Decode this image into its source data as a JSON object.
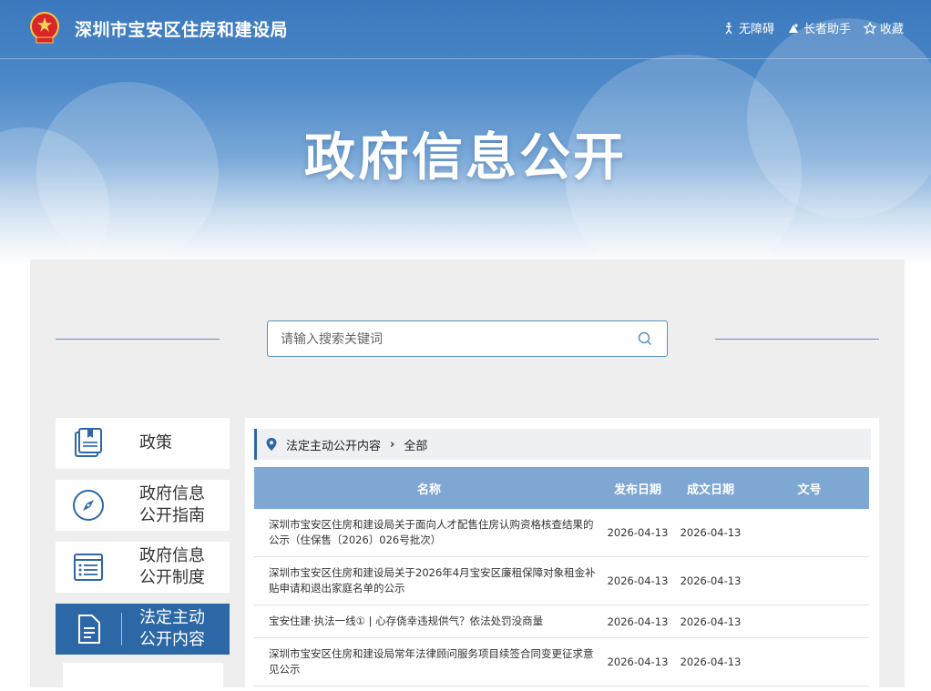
{
  "header": {
    "site_title": "深圳市宝安区住房和建设局",
    "links": [
      {
        "label": "无障碍",
        "icon": "accessibility-icon"
      },
      {
        "label": "长者助手",
        "icon": "elder-assist-icon"
      },
      {
        "label": "收藏",
        "icon": "star-icon"
      }
    ],
    "hero_title": "政府信息公开"
  },
  "search": {
    "placeholder": "请输入搜索关键词",
    "value": ""
  },
  "sidebar": {
    "items": [
      {
        "label": "政策",
        "icon": "policy-book-icon",
        "active": false
      },
      {
        "label": "政府信息公开指南",
        "line1": "政府信息",
        "line2": "公开指南",
        "icon": "compass-icon",
        "active": false
      },
      {
        "label": "政府信息公开制度",
        "line1": "政府信息",
        "line2": "公开制度",
        "icon": "list-document-icon",
        "active": false
      },
      {
        "label": "法定主动公开内容",
        "line1": "法定主动",
        "line2": "公开内容",
        "icon": "document-icon",
        "active": true
      }
    ]
  },
  "breadcrumb": {
    "section": "法定主动公开内容",
    "current": "全部"
  },
  "table": {
    "headers": [
      "名称",
      "发布日期",
      "成文日期",
      "文号"
    ],
    "rows": [
      {
        "title": "深圳市宝安区住房和建设局关于面向人才配售住房认购资格核查结果的公示（住保售〔2026〕026号批次）",
        "publish": "2026-04-13",
        "written": "2026-04-13",
        "doc_no": ""
      },
      {
        "title": "深圳市宝安区住房和建设局关于2026年4月宝安区廉租保障对象租金补贴申请和退出家庭名单的公示",
        "publish": "2026-04-13",
        "written": "2026-04-13",
        "doc_no": ""
      },
      {
        "title": "宝安住建·执法一线① | 心存侥幸违规供气？依法处罚没商量",
        "publish": "2026-04-13",
        "written": "2026-04-13",
        "doc_no": ""
      },
      {
        "title": "深圳市宝安区住房和建设局常年法律顾问服务项目续签合同变更征求意见公示",
        "publish": "2026-04-13",
        "written": "2026-04-13",
        "doc_no": ""
      }
    ]
  },
  "colors": {
    "primary": "#2c67a6",
    "table_header": "#7fa7d3",
    "accent_line": "#5a8fc4"
  }
}
